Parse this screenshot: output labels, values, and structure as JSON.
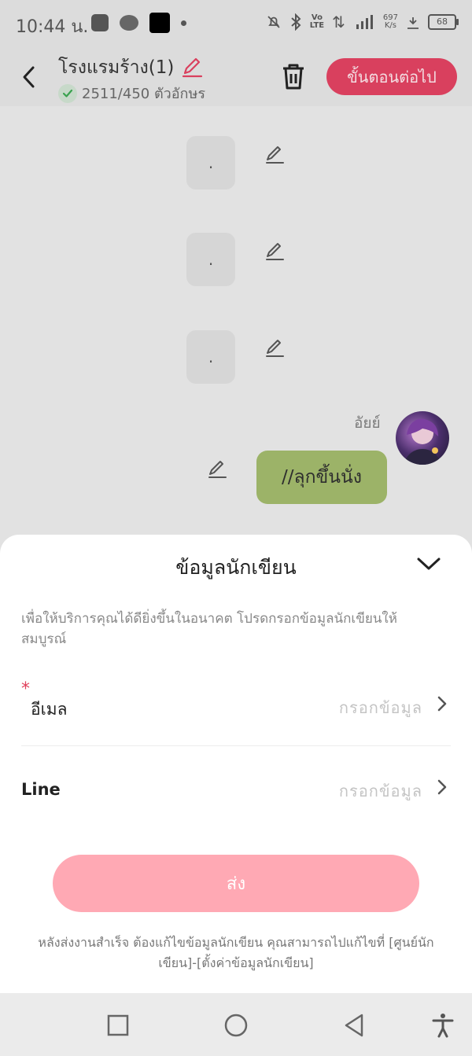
{
  "status_bar": {
    "time": "10:44 น.",
    "net_speed_value": "697",
    "net_speed_unit": "K/s",
    "battery": "68",
    "icons": [
      "app-p-icon",
      "line-app-icon",
      "black-app-icon",
      "dot-icon",
      "mute-bell-icon",
      "bluetooth-icon",
      "volte-icon",
      "data-arrows-icon",
      "signal-4g-icon",
      "wifi-icon",
      "battery-icon"
    ]
  },
  "header": {
    "title": "โรงแรมร้าง(1)",
    "char_count": "2511/450 ตัวอักษร",
    "next_label": "ขั้นตอนต่อไป",
    "accent_color": "#d9405e"
  },
  "chat": {
    "placeholders": [
      ".",
      ".",
      "."
    ],
    "speaker_name": "อัยย์",
    "message": "//ลุกขึ้นนั่ง",
    "bubble_color": "#9cb368"
  },
  "sheet": {
    "title": "ข้อมูลนักเขียน",
    "description": "เพื่อให้บริการคุณได้ดียิ่งขึ้นในอนาคต โปรดกรอกข้อมูลนักเขียนให้สมบูรณ์",
    "fields": [
      {
        "required_mark": "*",
        "label": "อีเมล",
        "placeholder": "กรอกข้อมูล"
      },
      {
        "label": "Line",
        "placeholder": "กรอกข้อมูล"
      }
    ],
    "submit_label": "ส่ง",
    "note": "หลังส่งงานสำเร็จ ต้องแก้ไขข้อมูลนักเขียน คุณสามารถไปแก้ไขที่ [ศูนย์นักเขียน]-[ตั้งค่าข้อมูลนักเขียน]"
  }
}
